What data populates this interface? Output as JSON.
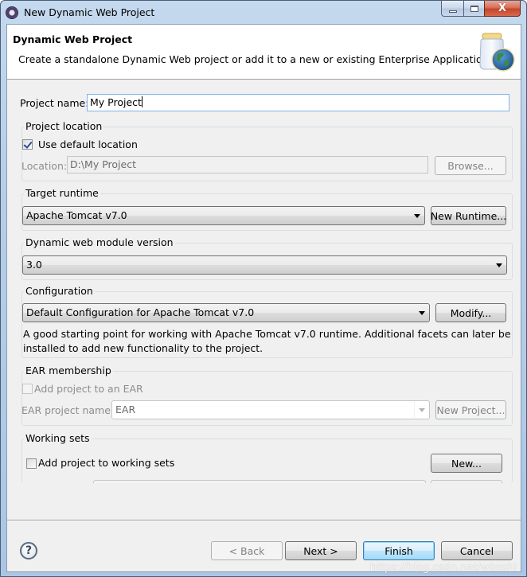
{
  "window": {
    "title": "New Dynamic Web Project",
    "controls": {
      "minimize": "minimize",
      "maximize": "maximize",
      "close": "X"
    }
  },
  "header": {
    "title": "Dynamic Web Project",
    "description": "Create a standalone Dynamic Web project or add it to a new or existing Enterprise Application.",
    "icon": "jar-globe-icon"
  },
  "project_name": {
    "label": "Project name:",
    "value": "My Project"
  },
  "project_location": {
    "group_label": "Project location",
    "use_default_label": "Use default location",
    "use_default_checked": true,
    "location_label": "Location:",
    "location_value": "D:\\My Project",
    "browse_label": "Browse..."
  },
  "target_runtime": {
    "group_label": "Target runtime",
    "selected": "Apache Tomcat v7.0",
    "new_runtime_label": "New Runtime..."
  },
  "module_version": {
    "group_label": "Dynamic web module version",
    "selected": "3.0"
  },
  "configuration": {
    "group_label": "Configuration",
    "selected": "Default Configuration for Apache Tomcat v7.0",
    "modify_label": "Modify...",
    "description_line1": "A good starting point for working with Apache Tomcat v7.0 runtime. Additional facets can later be",
    "description_line2": "installed to add new functionality to the project."
  },
  "ear_membership": {
    "group_label": "EAR membership",
    "add_label": "Add project to an EAR",
    "add_checked": false,
    "ear_name_label": "EAR project name:",
    "ear_name_value": "EAR",
    "new_project_label": "New Project..."
  },
  "working_sets": {
    "group_label": "Working sets",
    "add_label": "Add project to working sets",
    "add_checked": false,
    "new_label": "New..."
  },
  "footer": {
    "help_glyph": "?",
    "back_label": "< Back",
    "next_label": "Next >",
    "finish_label": "Finish",
    "cancel_label": "Cancel"
  },
  "watermark": "https://blog.csdn.net/wbxshi"
}
